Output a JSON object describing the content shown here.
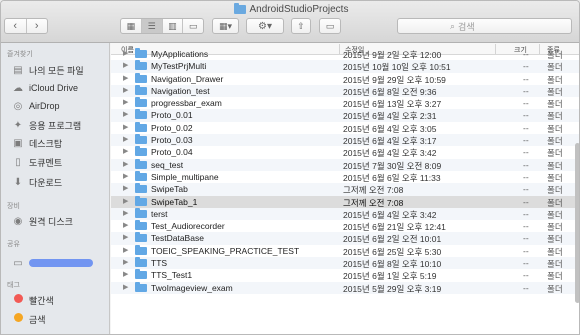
{
  "window": {
    "title": "AndroidStudioProjects"
  },
  "toolbar": {
    "back": "‹",
    "forward": "›",
    "views": [
      "▦",
      "☰",
      "▥",
      "▭"
    ],
    "arrange": "▦▾",
    "action": "⚙▾",
    "share": "⇧",
    "tag": "▭",
    "search_placeholder": "검색"
  },
  "sidebar": {
    "favorites_header": "즐겨찾기",
    "favorites": [
      {
        "label": "나의 모든 파일",
        "icon": "all-files-icon"
      },
      {
        "label": "iCloud Drive",
        "icon": "cloud-icon"
      },
      {
        "label": "AirDrop",
        "icon": "airdrop-icon"
      },
      {
        "label": "응용 프로그램",
        "icon": "applications-icon"
      },
      {
        "label": "데스크탑",
        "icon": "desktop-icon"
      },
      {
        "label": "도큐멘트",
        "icon": "documents-icon"
      },
      {
        "label": "다운로드",
        "icon": "downloads-icon"
      }
    ],
    "devices_header": "장비",
    "devices": [
      {
        "label": "원격 디스크",
        "icon": "remote-disc-icon"
      }
    ],
    "shared_header": "공유",
    "tags_header": "태그",
    "tags": [
      {
        "label": "빨간색",
        "color": "#f25a55"
      },
      {
        "label": "금색",
        "color": "#f5a623"
      }
    ]
  },
  "columns": {
    "name": "이름",
    "modified": "수정일",
    "size": "크기",
    "kind": "종류"
  },
  "files": [
    {
      "name": "MyApplications",
      "modified": "2015년 9월 2일 오후 12:00",
      "size": "--",
      "kind": "폴더"
    },
    {
      "name": "MyTestPrjMulti",
      "modified": "2015년 10월 10일 오후 10:51",
      "size": "--",
      "kind": "폴더"
    },
    {
      "name": "Navigation_Drawer",
      "modified": "2015년 9월 29일 오후 10:59",
      "size": "--",
      "kind": "폴더"
    },
    {
      "name": "Navigation_test",
      "modified": "2015년 6월 8일 오전 9:36",
      "size": "--",
      "kind": "폴더"
    },
    {
      "name": "progressbar_exam",
      "modified": "2015년 6월 13일 오후 3:27",
      "size": "--",
      "kind": "폴더"
    },
    {
      "name": "Proto_0.01",
      "modified": "2015년 6월 4일 오후 2:31",
      "size": "--",
      "kind": "폴더"
    },
    {
      "name": "Proto_0.02",
      "modified": "2015년 6월 4일 오후 3:05",
      "size": "--",
      "kind": "폴더"
    },
    {
      "name": "Proto_0.03",
      "modified": "2015년 6월 4일 오후 3:17",
      "size": "--",
      "kind": "폴더"
    },
    {
      "name": "Proto_0.04",
      "modified": "2015년 6월 4일 오후 3:42",
      "size": "--",
      "kind": "폴더"
    },
    {
      "name": "seq_test",
      "modified": "2015년 7월 30일 오전 8:09",
      "size": "--",
      "kind": "폴더"
    },
    {
      "name": "Simple_multipane",
      "modified": "2015년 6월 6일 오후 11:33",
      "size": "--",
      "kind": "폴더"
    },
    {
      "name": "SwipeTab",
      "modified": "그저께 오전 7:08",
      "size": "--",
      "kind": "폴더"
    },
    {
      "name": "SwipeTab_1",
      "modified": "그저께 오전 7:08",
      "size": "--",
      "kind": "폴더"
    },
    {
      "name": "terst",
      "modified": "2015년 6월 4일 오후 3:42",
      "size": "--",
      "kind": "폴더"
    },
    {
      "name": "Test_Audiorecorder",
      "modified": "2015년 6월 21일 오후 12:41",
      "size": "--",
      "kind": "폴더"
    },
    {
      "name": "TestDataBase",
      "modified": "2015년 6월 2일 오전 10:01",
      "size": "--",
      "kind": "폴더"
    },
    {
      "name": "TOEIC_SPEAKING_PRACTICE_TEST",
      "modified": "2015년 6월 25일 오후 5:30",
      "size": "--",
      "kind": "폴더"
    },
    {
      "name": "TTS",
      "modified": "2015년 6월 8일 오후 10:10",
      "size": "--",
      "kind": "폴더"
    },
    {
      "name": "TTS_Test1",
      "modified": "2015년 6월 1일 오후 5:19",
      "size": "--",
      "kind": "폴더"
    },
    {
      "name": "TwoImageview_exam",
      "modified": "2015년 5월 29일 오후 3:19",
      "size": "--",
      "kind": "폴더"
    }
  ],
  "selected_file": "SwipeTab_1",
  "colors": {
    "folder": "#62a8e5",
    "selection": "#dcdcdc",
    "sidebar": "#e5e8ec"
  }
}
